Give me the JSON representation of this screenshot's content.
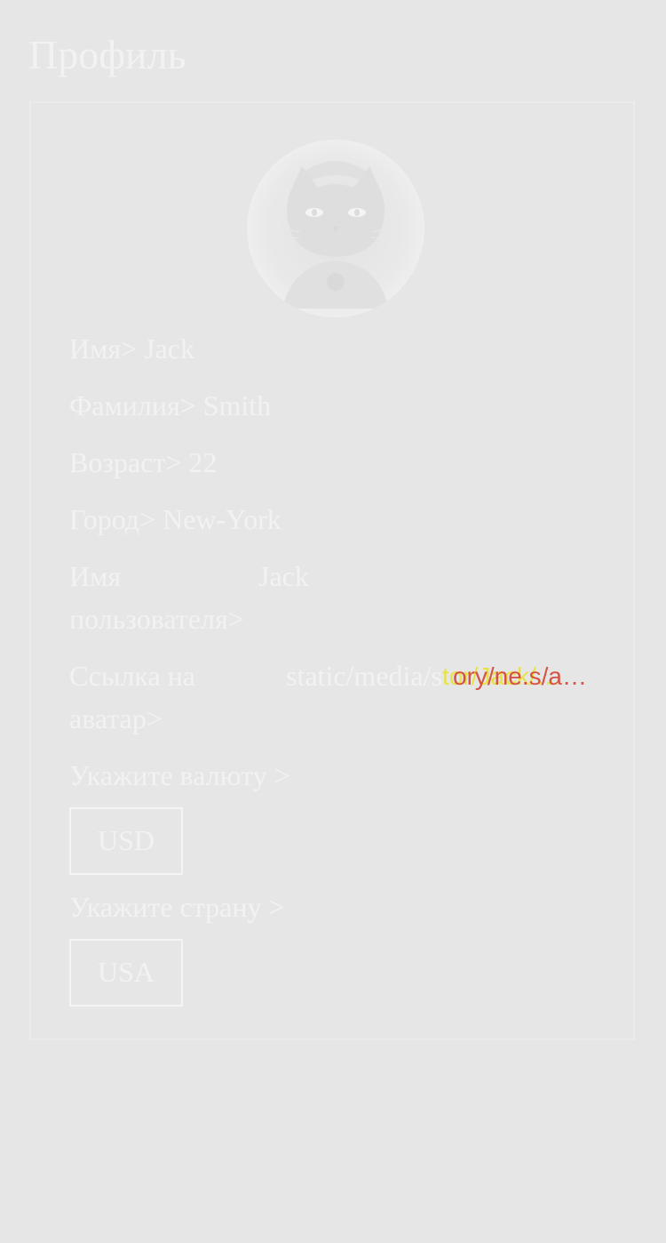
{
  "page": {
    "title": "Профиль"
  },
  "profile": {
    "avatar_icon": "black-cat-avatar",
    "first_name": {
      "label": "Имя>",
      "value": "Jack"
    },
    "last_name": {
      "label": "Фамилия>",
      "value": "Smith"
    },
    "age": {
      "label": "Возраст>",
      "value": "22"
    },
    "city": {
      "label": "Город>",
      "value": "New-York"
    },
    "username": {
      "label": "Имя пользователя>",
      "value": "Jack"
    },
    "avatar_link": {
      "label": "Ссылка на аватар>",
      "value": "static/media/s",
      "overlay_a": "tor/Jack/…",
      "overlay_b": "ory/ne.s/a…"
    },
    "currency": {
      "label": "Укажите валюту >",
      "selected": "USD"
    },
    "country": {
      "label": "Укажите страну >",
      "selected": "USA"
    }
  },
  "colors": {
    "background": "#e6e6e6",
    "text": "#f2f2f2",
    "overlay_yellow": "#e7e24a",
    "overlay_red": "#d43a2a"
  }
}
